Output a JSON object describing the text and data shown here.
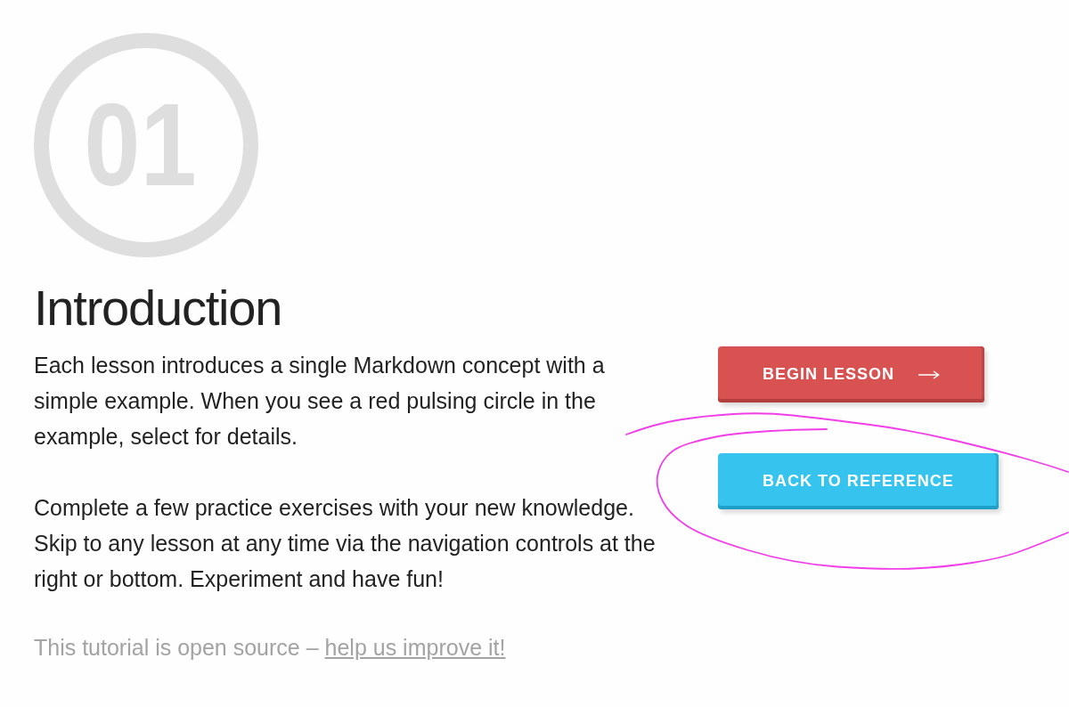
{
  "lesson": {
    "number": "01"
  },
  "title": "Introduction",
  "paragraphs": [
    "Each lesson introduces a single Markdown concept with a simple example. When you see a red pulsing circle in the example, select for details.",
    "Complete a few practice exercises with your new knowledge. Skip to any lesson at any time via the navigation controls at the right or bottom. Experiment and have fun!"
  ],
  "footer": {
    "text": "This tutorial is open source –",
    "link": "help us improve it!"
  },
  "buttons": [
    {
      "label": "BEGIN LESSON",
      "kind": "primary"
    },
    {
      "label": "BACK TO REFERENCE",
      "kind": "secondary"
    }
  ]
}
